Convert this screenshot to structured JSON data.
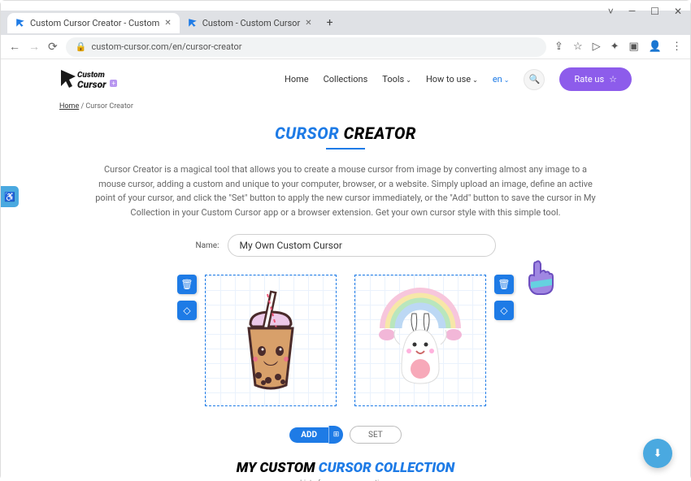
{
  "window": {
    "controls": {
      "down": "˅",
      "min": "—",
      "max": "☐",
      "close": "✕"
    }
  },
  "tabs": [
    {
      "title": "Custom Cursor Creator - Custom",
      "active": true
    },
    {
      "title": "Custom - Custom Cursor",
      "active": false
    }
  ],
  "address": {
    "lock": "🔒",
    "url": "custom-cursor.com/en/cursor-creator"
  },
  "toolbar_icons": [
    "⇪",
    "☆",
    "▷",
    "✦",
    "▣",
    "👤",
    "⋮"
  ],
  "nav": {
    "menu": [
      "Home",
      "Collections"
    ],
    "tools": "Tools",
    "howto": "How to use",
    "lang": "en",
    "rate": "Rate us"
  },
  "breadcrumb": {
    "home": "Home",
    "sep": " / ",
    "current": "Cursor Creator"
  },
  "page": {
    "title_blue": "CURSOR",
    "title_rest": " CREATOR",
    "desc": "Cursor Creator is a magical tool that allows you to create a mouse cursor from image by converting almost any image to a mouse cursor, adding a custom and unique to your computer, browser, or a website. Simply upload an image, define an active point of your cursor, and click the \"Set\" button to apply the new cursor immediately, or the \"Add\" button to save the cursor in My Collection in your Custom Cursor app or a browser extension. Get your own cursor style with this simple tool.",
    "name_label": "Name:",
    "name_value": "My Own Custom Cursor",
    "add": "ADD",
    "set": "SET"
  },
  "collection": {
    "title_left": "MY CUSTOM ",
    "title_blue": "CURSOR COLLECTION",
    "sub": "List of your cursor creations"
  }
}
